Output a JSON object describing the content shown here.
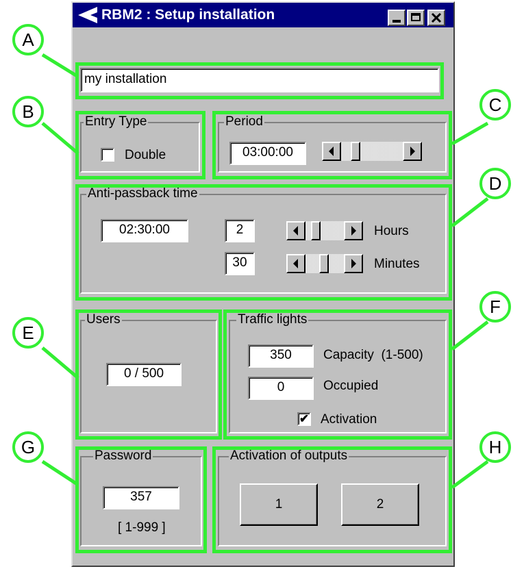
{
  "window": {
    "title": "RBM2 : Setup installation",
    "colors": {
      "title_bar": "#000080",
      "face": "#c0c0c0",
      "highlight": "#33ee33"
    }
  },
  "installation_name": "my installation",
  "entry_type": {
    "title": "Entry Type",
    "double_label": "Double",
    "double_checked": false
  },
  "period": {
    "title": "Period",
    "value": "03:00:00",
    "scroll_level": 0.25
  },
  "anti_passback": {
    "title": "Anti-passback time",
    "total": "02:30:00",
    "hours_value": "2",
    "hours_label": "Hours",
    "minutes_value": "30",
    "minutes_label": "Minutes"
  },
  "users": {
    "title": "Users",
    "value": "0 / 500"
  },
  "traffic_lights": {
    "title": "Traffic lights",
    "capacity_value": "350",
    "capacity_label": "Capacity  (1-500)",
    "occupied_value": "0",
    "occupied_label": "Occupied",
    "activation_label": "Activation",
    "activation_checked": true
  },
  "password": {
    "title": "Password",
    "value": "357",
    "range": "[ 1-999 ]"
  },
  "outputs": {
    "title": "Activation of outputs",
    "button1": "1",
    "button2": "2"
  },
  "callouts": [
    "A",
    "B",
    "C",
    "D",
    "E",
    "F",
    "G",
    "H"
  ]
}
